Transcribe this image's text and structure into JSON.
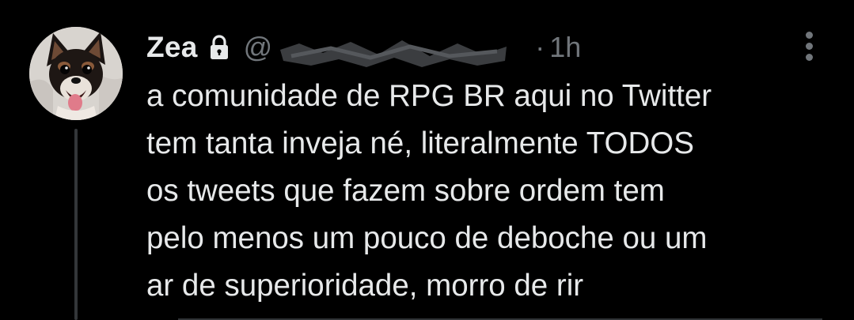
{
  "tweet": {
    "author_name": "Zea",
    "handle_visible": "@",
    "separator": "·",
    "time": "1h",
    "text_lines": [
      "a comunidade de RPG BR aqui no Twitter",
      "tem tanta inveja né, literalmente TODOS",
      "os tweets que fazem sobre ordem tem",
      "pelo menos um pouco de deboche ou um",
      "ar de superioridade, morro de rir"
    ],
    "protected_icon": "lock-icon",
    "more_icon": "more-vertical-icon",
    "avatar": "dog-avatar"
  },
  "colors": {
    "background": "#000000",
    "primary_text": "#e7e9ea",
    "secondary_text": "#71767b",
    "thread_line": "#333639"
  }
}
